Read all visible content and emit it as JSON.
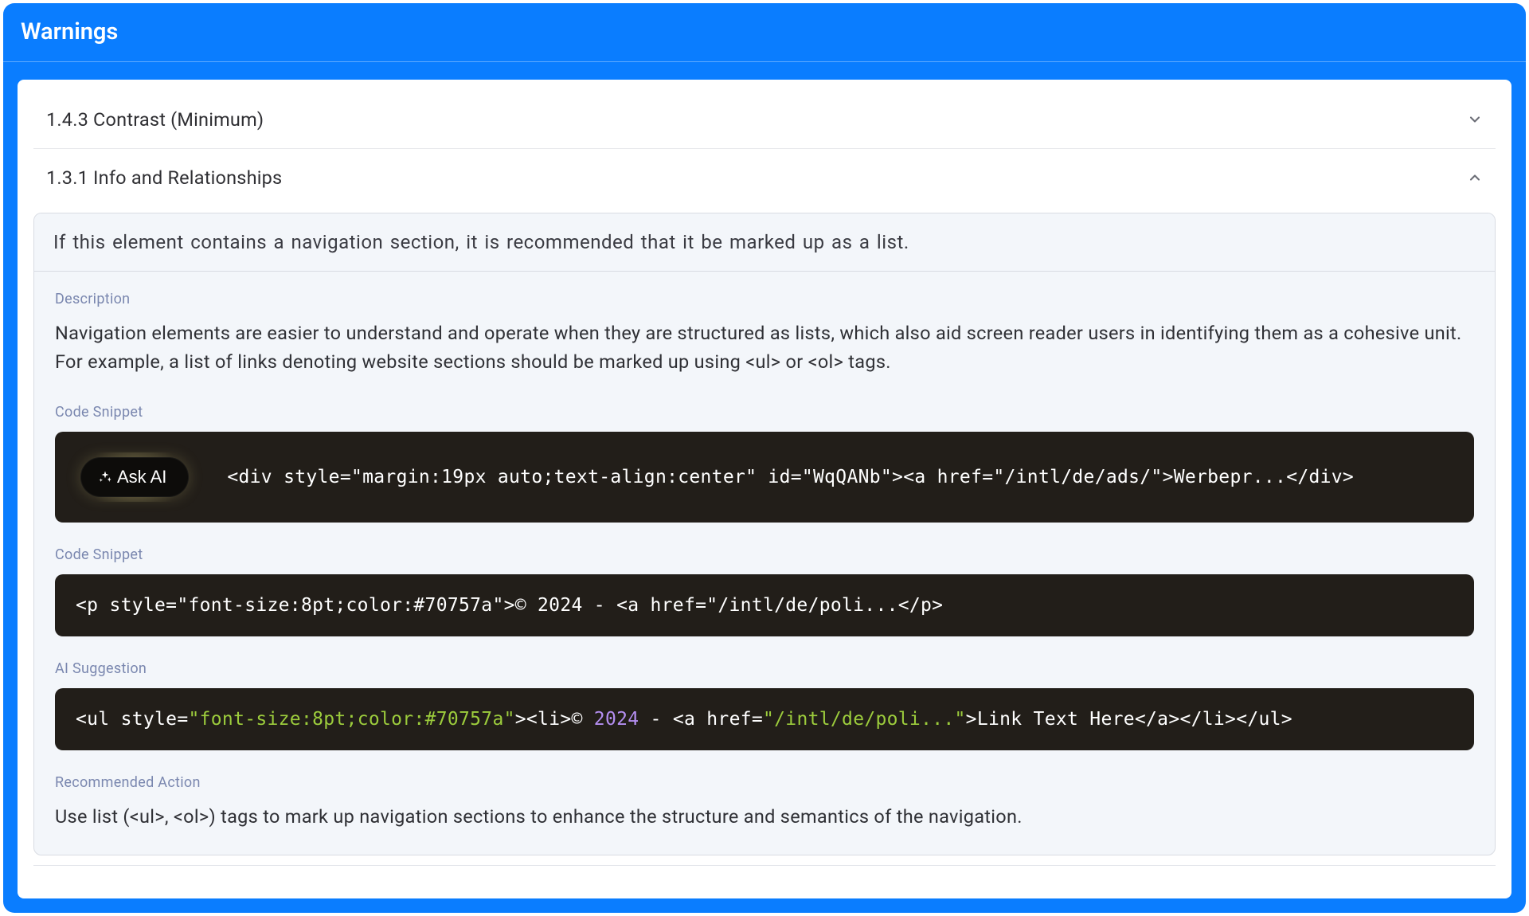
{
  "header": {
    "title": "Warnings"
  },
  "accordion": {
    "items": [
      {
        "label": "1.4.3 Contrast (Minimum)",
        "expanded": false
      },
      {
        "label": "1.3.1 Info and Relationships",
        "expanded": true
      }
    ]
  },
  "detail": {
    "banner": "If this element contains a navigation section, it is recommended that it be marked up as a list.",
    "description_label": "Description",
    "description_text": "Navigation elements are easier to understand and operate when they are structured as lists, which also aid screen reader users in identifying them as a cohesive unit. For example, a list of links denoting website sections should be marked up using <ul> or <ol> tags.",
    "snippet1_label": "Code Snippet",
    "ask_ai_label": "Ask AI",
    "snippet1_code": "<div style=\"margin:19px auto;text-align:center\" id=\"WqQANb\"><a href=\"/intl/de/ads/\">Werbepr...</div>",
    "snippet2_label": "Code Snippet",
    "snippet2_code": "<p style=\"font-size:8pt;color:#70757a\">© 2024 - <a href=\"/intl/de/poli...</p>",
    "ai_label": "AI Suggestion",
    "ai_suggestion": {
      "p1": "<ul style=",
      "s1": "\"font-size:8pt;color:#70757a\"",
      "p2": "><li>© ",
      "n1": "2024",
      "p3": " - <a href=",
      "s2": "\"/intl/de/poli...\"",
      "p4": ">Link Text Here</a></li></ul>"
    },
    "recommended_label": "Recommended Action",
    "recommended_text": "Use list (<ul>, <ol>) tags to mark up navigation sections to enhance the structure and semantics of the navigation."
  }
}
